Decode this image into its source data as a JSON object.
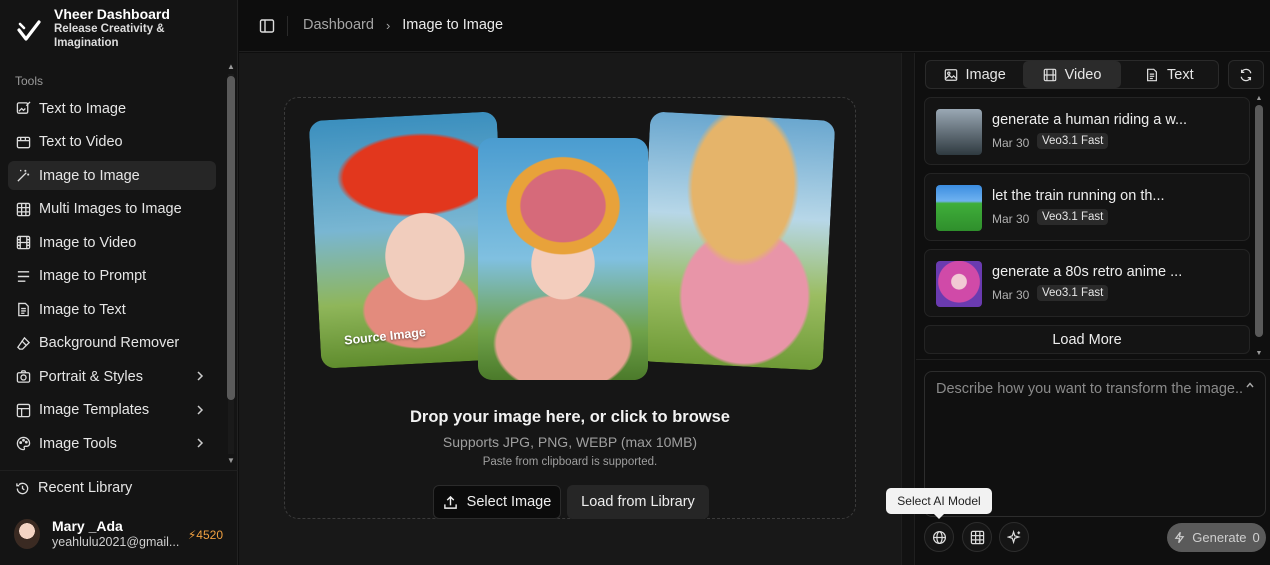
{
  "brand": {
    "title": "Vheer Dashboard",
    "subtitle": "Release Creativity & Imagination"
  },
  "sidebar": {
    "section_label": "Tools",
    "items": [
      {
        "label": "Text to Image",
        "icon": "image-edit-icon"
      },
      {
        "label": "Text to Video",
        "icon": "video-text-icon"
      },
      {
        "label": "Image to Image",
        "icon": "magic-wand-icon",
        "active": true
      },
      {
        "label": "Multi Images to Image",
        "icon": "grid-icon"
      },
      {
        "label": "Image to Video",
        "icon": "film-icon"
      },
      {
        "label": "Image to Prompt",
        "icon": "lines-icon"
      },
      {
        "label": "Image to Text",
        "icon": "document-icon"
      },
      {
        "label": "Background Remover",
        "icon": "eraser-icon"
      },
      {
        "label": "Portrait & Styles",
        "icon": "camera-icon",
        "chevron": true
      },
      {
        "label": "Image Templates",
        "icon": "template-icon",
        "chevron": true
      },
      {
        "label": "Image Tools",
        "icon": "palette-icon",
        "chevron": true
      }
    ],
    "recent_label": "Recent Library"
  },
  "user": {
    "name": "Mary _Ada",
    "email": "yeahlulu2021@gmail...",
    "credits": "4520"
  },
  "breadcrumb": {
    "parent": "Dashboard",
    "current": "Image to Image"
  },
  "dropzone": {
    "source_label": "Source Image",
    "title": "Drop your image here, or click to browse",
    "supports": "Supports JPG, PNG, WEBP (max 10MB)",
    "note": "Paste from clipboard is supported.",
    "select_label": "Select Image",
    "library_label": "Load from Library"
  },
  "right_panel": {
    "tabs": [
      {
        "label": "Image",
        "icon": "image-icon"
      },
      {
        "label": "Video",
        "icon": "film-icon",
        "active": true
      },
      {
        "label": "Text",
        "icon": "document-icon"
      }
    ],
    "history": [
      {
        "title": "generate a human riding a w...",
        "date": "Mar 30",
        "badge": "Veo3.1 Fast"
      },
      {
        "title": "let the train running on th...",
        "date": "Mar 30",
        "badge": "Veo3.1 Fast"
      },
      {
        "title": "generate a 80s retro anime ...",
        "date": "Mar 30",
        "badge": "Veo3.1 Fast"
      }
    ],
    "load_more": "Load More",
    "prompt_placeholder": "Describe how you want to transform the image...",
    "tooltip": "Select AI Model",
    "generate_label": "Generate",
    "generate_count": "0"
  }
}
